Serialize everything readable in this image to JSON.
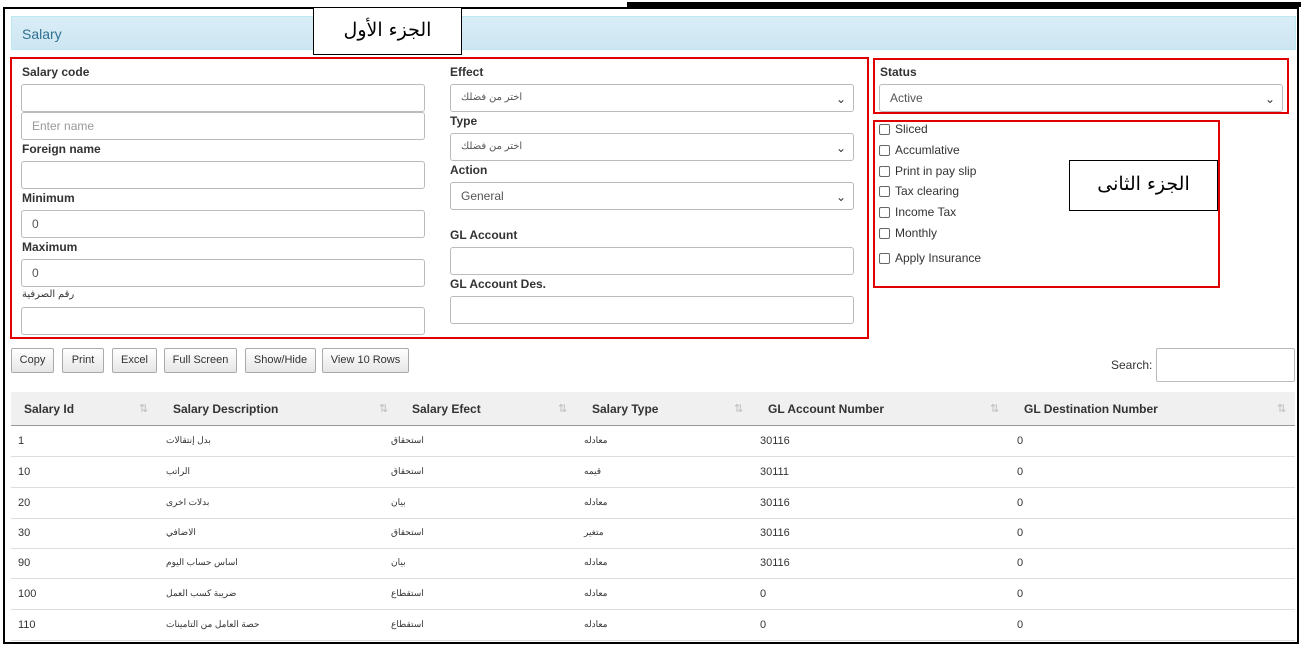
{
  "panel": {
    "title": "Salary"
  },
  "annotations": {
    "part1": "الجزء الأول",
    "part2": "الجزء الثانى"
  },
  "form": {
    "salary_code": {
      "label": "Salary code",
      "value": ""
    },
    "name": {
      "placeholder": "Enter name"
    },
    "foreign_name": {
      "label": "Foreign name",
      "value": ""
    },
    "minimum": {
      "label": "Minimum",
      "value": "0"
    },
    "maximum": {
      "label": "Maximum",
      "value": "0"
    },
    "serial_no": {
      "label": "رقم الصرفية",
      "value": ""
    },
    "effect": {
      "label": "Effect",
      "value": "اختر من فضلك"
    },
    "type": {
      "label": "Type",
      "value": "اختر من فضلك"
    },
    "action": {
      "label": "Action",
      "value": "General"
    },
    "gl_account": {
      "label": "GL Account",
      "value": ""
    },
    "gl_account_des": {
      "label": "GL Account Des.",
      "value": ""
    },
    "status": {
      "label": "Status",
      "value": "Active"
    }
  },
  "checkboxes": [
    "Sliced",
    "Accumlative",
    "Print in pay slip",
    "Tax clearing",
    "Income Tax",
    "Monthly",
    "Apply Insurance"
  ],
  "toolbar": {
    "copy": "Copy",
    "print": "Print",
    "excel": "Excel",
    "full_screen": "Full Screen",
    "show_hide": "Show/Hide",
    "view_rows": "View 10 Rows",
    "search_label": "Search:"
  },
  "table": {
    "headers": [
      "Salary Id",
      "Salary Description",
      "Salary Efect",
      "Salary Type",
      "GL Account Number",
      "GL Destination Number"
    ],
    "sort_icon": "⇅",
    "rows": [
      [
        "1",
        "بدل إنتقالات",
        "استحقاق",
        "معادله",
        "30116",
        "0"
      ],
      [
        "10",
        "الراتب",
        "استحقاق",
        "قيمه",
        "30111",
        "0"
      ],
      [
        "20",
        "بدلات اخرى",
        "بيان",
        "معادله",
        "30116",
        "0"
      ],
      [
        "30",
        "الاضافي",
        "استحقاق",
        "متغير",
        "30116",
        "0"
      ],
      [
        "90",
        "اساس حساب اليوم",
        "بيان",
        "معادله",
        "30116",
        "0"
      ],
      [
        "100",
        "ضريبة كسب العمل",
        "استقطاع",
        "معادله",
        "0",
        "0"
      ],
      [
        "110",
        "حصة العامل من التامينات",
        "استقطاع",
        "معادله",
        "0",
        "0"
      ]
    ]
  }
}
